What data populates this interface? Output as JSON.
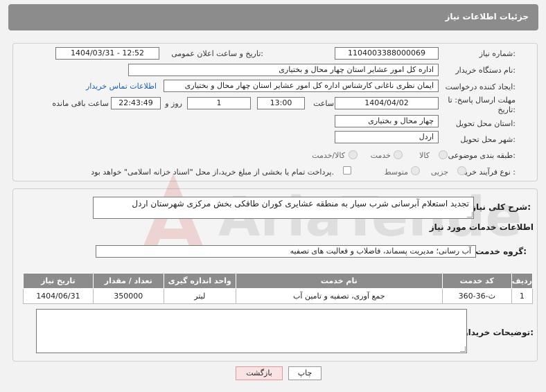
{
  "header": {
    "title": "جزئیات اطلاعات نیاز"
  },
  "need_number": {
    "label": "شماره نیاز:",
    "value": "1104003388000069"
  },
  "announce_date": {
    "label": "تاریخ و ساعت اعلان عمومی:",
    "value": "1404/03/31 - 12:52"
  },
  "buyer_org": {
    "label": "نام دستگاه خریدار:",
    "value": "اداره کل امور عشایر استان چهار محال و بختیاری"
  },
  "requester": {
    "label": "ایجاد کننده درخواست:",
    "value": "ایمان نظری ناغانی کارشناس اداره کل امور عشایر استان چهار محال و بختیاری",
    "contact_link": "اطلاعات تماس خریدار"
  },
  "deadline": {
    "label_line1": "مهلت ارسال پاسخ: تا",
    "label_line2": "تاریخ:",
    "date": "1404/04/02",
    "time_label": "ساعت",
    "time": "13:00",
    "days": "1",
    "days_label": "روز و",
    "remaining": "22:43:49",
    "remaining_label": "ساعت باقی مانده"
  },
  "province": {
    "label": "استان محل تحویل:",
    "value": "چهار محال و بختیاری"
  },
  "city": {
    "label": "شهر محل تحویل:",
    "value": "اردل"
  },
  "category": {
    "label": "طبقه بندی موضوعی:",
    "options": [
      "کالا",
      "خدمت",
      "کالا/خدمت"
    ]
  },
  "process": {
    "label": "نوع فرآیند خرید :",
    "options": [
      "جزیی",
      "متوسط"
    ],
    "payment_note": "پرداخت تمام یا بخشی از مبلغ خرید،از محل \"اسناد خزانه اسلامی\" خواهد بود."
  },
  "summary": {
    "label": "شرح کلی نیاز:",
    "value": "تجدید استعلام آبرسانی شرب سیار به منطقه عشایری کوران طاقکی بخش مرکزی شهرستان اردل"
  },
  "services_info": {
    "title": "اطلاعات خدمات مورد نیاز"
  },
  "service_group": {
    "label": "گروه خدمت:",
    "value": "آب رسانی؛ مدیریت پسماند، فاضلاب و فعالیت های تصفیه"
  },
  "table": {
    "headers": [
      "ردیف",
      "کد خدمت",
      "نام خدمت",
      "واحد اندازه گیری",
      "تعداد / مقدار",
      "تاریخ نیاز"
    ],
    "rows": [
      [
        "1",
        "ث-36-360",
        "جمع آوری، تصفیه و تامین آب",
        "لیتر",
        "350000",
        "1404/06/31"
      ]
    ]
  },
  "buyer_notes": {
    "label": "توضیحات خریدار:",
    "value": ""
  },
  "buttons": {
    "print": "چاپ",
    "back": "بازگشت"
  },
  "watermark": {
    "text": "AriaTender.neT"
  },
  "colors": {
    "header_bg": "#8c8c8c",
    "link": "#1a5fb4",
    "back_btn_bg": "#fbe3e3"
  }
}
